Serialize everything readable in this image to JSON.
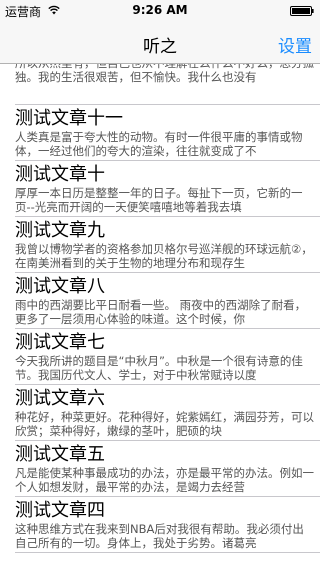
{
  "status_bar": {
    "carrier": "运营商",
    "time": "9:26 AM"
  },
  "nav": {
    "title": "听之",
    "settings_label": "设置"
  },
  "articles": [
    {
      "title": "",
      "excerpt": "所以从然里有，但自己也从不理解在么什么不好么，总分孤独。我的生活很艰苦，但不愉快。我什么也没有"
    },
    {
      "title": "测试文章十一",
      "excerpt": "人类真是富于夸大性的动物。有时一件很平庸的事情或物体，一经过他们的夸大的渲染，往往就变成了不"
    },
    {
      "title": "测试文章十",
      "excerpt": "厚厚一本日历是整整一年的日子。每扯下一页，它新的一页--光亮而开阔的一天便笑嘻嘻地等着我去填"
    },
    {
      "title": "测试文章九",
      "excerpt": "我曾以博物学者的资格参加贝格尔号巡洋舰的环球远航②，在南美洲看到的关于生物的地理分布和现存生"
    },
    {
      "title": "测试文章八",
      "excerpt": "雨中的西湖要比平日耐看一些。 雨夜中的西湖除了耐看，更多了一层须用心体验的味道。这个时候，你"
    },
    {
      "title": "测试文章七",
      "excerpt": "今天我所讲的题目是“中秋月”。中秋是一个很有诗意的佳节。我国历代文人、学士，对于中秋常赋诗以度"
    },
    {
      "title": "测试文章六",
      "excerpt": "种花好，种菜更好。花种得好，姹紫嫣红，满园芬芳，可以欣赏；菜种得好，嫩绿的茎叶，肥硕的块"
    },
    {
      "title": "测试文章五",
      "excerpt": "凡是能使某种事最成功的办法，亦是最平常的办法。例如一个人如想发财，最平常的办法，是竭力去经营"
    },
    {
      "title": "测试文章四",
      "excerpt": "这种思维方式在我来到NBA后对我很有帮助。我必须付出自己所有的一切。身体上，我处于劣势。诸葛亮"
    }
  ],
  "colors": {
    "accent": "#1a8cff",
    "bar_background": "#f7f7f7",
    "separator": "#c8c7cc"
  }
}
